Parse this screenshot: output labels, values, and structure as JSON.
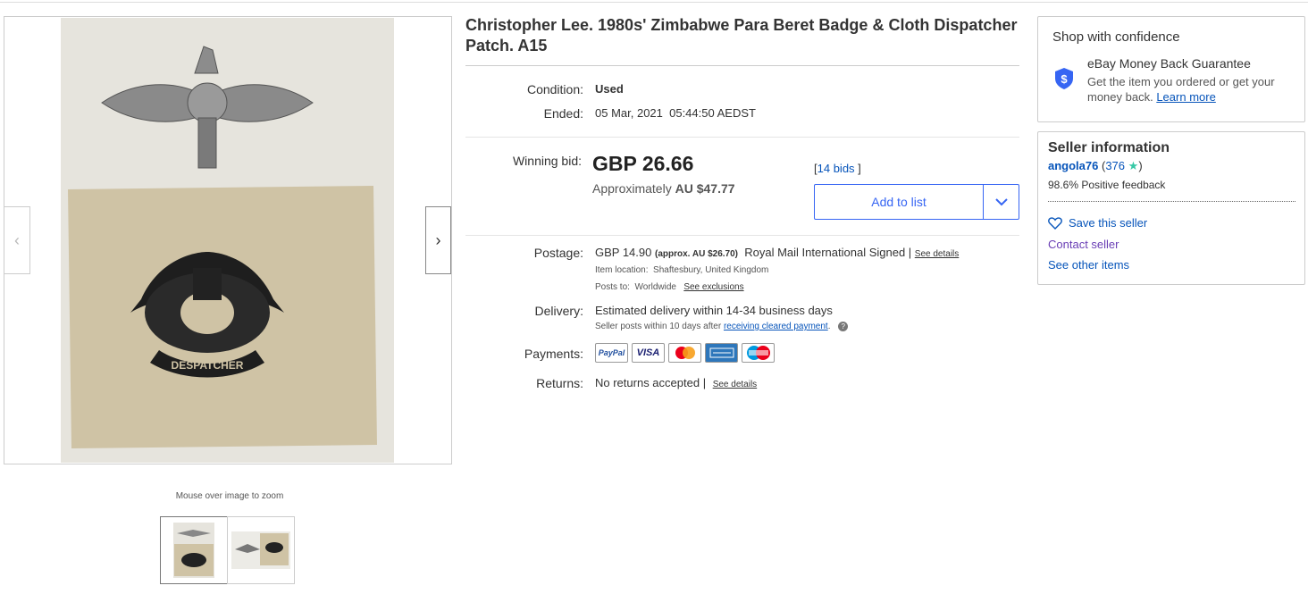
{
  "listing": {
    "title": "Christopher Lee. 1980s' Zimbabwe Para Beret Badge & Cloth Dispatcher Patch. A15",
    "condition_label": "Condition:",
    "condition_value": "Used",
    "ended_label": "Ended:",
    "ended_value": "05 Mar, 2021  05:44:50 AEDST",
    "winning_bid_label": "Winning bid:",
    "winning_bid_value": "GBP 26.66",
    "approx_prefix": "Approximately",
    "approx_value": "AU $47.77",
    "bids_open": "[",
    "bids_count": "14 bids",
    "bids_close": " ]",
    "add_to_list": "Add to list"
  },
  "shipping": {
    "postage_label": "Postage:",
    "postage_price": "GBP 14.90",
    "postage_approx": "(approx. AU $26.70)",
    "postage_service": "Royal Mail International Signed",
    "see_details": "See details",
    "item_location_label": "Item location:",
    "item_location": "Shaftesbury, United Kingdom",
    "posts_to_label": "Posts to:",
    "posts_to": "Worldwide",
    "see_exclusions": "See exclusions",
    "delivery_label": "Delivery:",
    "delivery_value": "Estimated delivery within 14-34 business days",
    "delivery_note_prefix": "Seller posts within 10 days after",
    "delivery_note_link": "receiving cleared payment",
    "payments_label": "Payments:",
    "payment_methods": [
      "PayPal",
      "VISA",
      "Mastercard",
      "American Express",
      "Maestro"
    ],
    "returns_label": "Returns:",
    "returns_value": "No returns accepted",
    "returns_details": "See details"
  },
  "gallery": {
    "zoom_hint": "Mouse over image to zoom",
    "prev_icon": "chevron-left-icon",
    "next_icon": "chevron-right-icon",
    "photo_caption": "DESPATCHER"
  },
  "confidence": {
    "heading": "Shop with confidence",
    "guarantee_title": "eBay Money Back Guarantee",
    "guarantee_text": "Get the item you ordered or get your money back.",
    "learn_more": "Learn more"
  },
  "seller": {
    "heading": "Seller information",
    "name": "angola76",
    "feedback_count": "376",
    "feedback_percent": "98.6% Positive feedback",
    "save_seller": "Save this seller",
    "contact_seller": "Contact seller",
    "other_items": "See other items"
  },
  "colors": {
    "link_blue": "#0654ba",
    "brand_blue": "#3665f3",
    "star_teal": "#36c8a6",
    "patch_beige": "#cfc3a5"
  }
}
